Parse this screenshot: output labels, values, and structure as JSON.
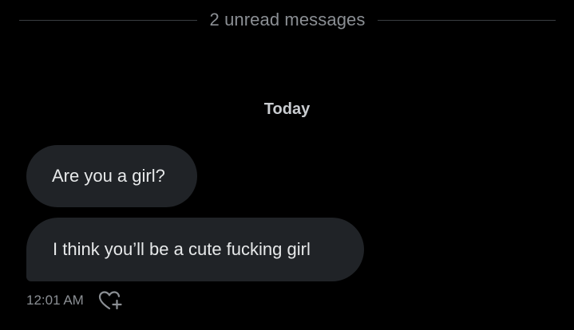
{
  "divider": {
    "unread_label": "2 unread messages"
  },
  "date_separator": {
    "label": "Today"
  },
  "messages": [
    {
      "text": "Are you a girl?"
    },
    {
      "text": "I think you’ll be a cute fucking girl"
    }
  ],
  "meta": {
    "timestamp": "12:01 AM",
    "react_icon": "heart-plus-icon"
  },
  "colors": {
    "background": "#000000",
    "bubble": "#202327",
    "text": "#e7e9ea",
    "muted_text": "#8b8f94",
    "divider": "#3a3d41"
  }
}
